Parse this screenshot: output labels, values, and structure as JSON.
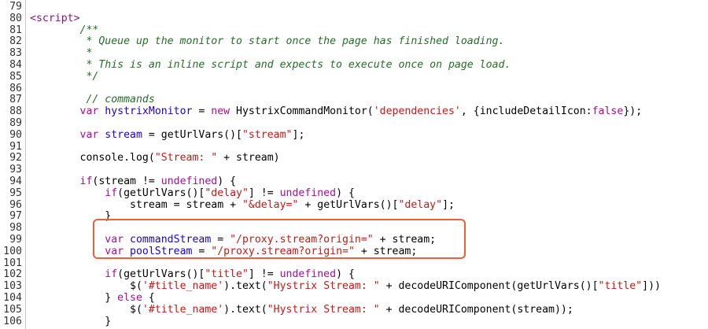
{
  "colors": {
    "tag": "#881280",
    "keyword": "#aa0d91",
    "identifier": "#1c00cf",
    "string": "#c41a16",
    "comment": "#236e25",
    "highlight_border": "#e8603c"
  },
  "lines": [
    {
      "n": "79",
      "indent": "",
      "tokens": []
    },
    {
      "n": "80",
      "indent": "",
      "tokens": [
        {
          "t": "tag",
          "v": "<script>"
        }
      ]
    },
    {
      "n": "81",
      "indent": "        ",
      "tokens": [
        {
          "t": "com",
          "v": "/**"
        }
      ]
    },
    {
      "n": "82",
      "indent": "         ",
      "tokens": [
        {
          "t": "com",
          "v": "* Queue up the monitor to start once the page has finished loading."
        }
      ]
    },
    {
      "n": "83",
      "indent": "         ",
      "tokens": [
        {
          "t": "com",
          "v": "*"
        }
      ]
    },
    {
      "n": "84",
      "indent": "         ",
      "tokens": [
        {
          "t": "com",
          "v": "* This is an inline script and expects to execute once on page load."
        }
      ]
    },
    {
      "n": "85",
      "indent": "         ",
      "tokens": [
        {
          "t": "com",
          "v": "*/"
        }
      ]
    },
    {
      "n": "86",
      "indent": "",
      "tokens": []
    },
    {
      "n": "87",
      "indent": "         ",
      "tokens": [
        {
          "t": "com",
          "v": "// commands"
        }
      ]
    },
    {
      "n": "88",
      "indent": "        ",
      "tokens": [
        {
          "t": "kw",
          "v": "var "
        },
        {
          "t": "var",
          "v": "hystrixMonitor"
        },
        {
          "t": "pl",
          "v": " = "
        },
        {
          "t": "kw",
          "v": "new "
        },
        {
          "t": "pl",
          "v": "HystrixCommandMonitor("
        },
        {
          "t": "str",
          "v": "'dependencies'"
        },
        {
          "t": "pl",
          "v": ", {includeDetailIcon:"
        },
        {
          "t": "kw",
          "v": "false"
        },
        {
          "t": "pl",
          "v": "});"
        }
      ]
    },
    {
      "n": "89",
      "indent": "",
      "tokens": []
    },
    {
      "n": "90",
      "indent": "        ",
      "tokens": [
        {
          "t": "kw",
          "v": "var "
        },
        {
          "t": "var",
          "v": "stream"
        },
        {
          "t": "pl",
          "v": " = getUrlVars()["
        },
        {
          "t": "str",
          "v": "\"stream\""
        },
        {
          "t": "pl",
          "v": "];"
        }
      ]
    },
    {
      "n": "91",
      "indent": "",
      "tokens": []
    },
    {
      "n": "92",
      "indent": "        ",
      "tokens": [
        {
          "t": "pl",
          "v": "console.log("
        },
        {
          "t": "str",
          "v": "\"Stream: \""
        },
        {
          "t": "pl",
          "v": " + stream)"
        }
      ]
    },
    {
      "n": "93",
      "indent": "",
      "tokens": []
    },
    {
      "n": "94",
      "indent": "        ",
      "tokens": [
        {
          "t": "kw",
          "v": "if"
        },
        {
          "t": "pl",
          "v": "(stream != "
        },
        {
          "t": "kw",
          "v": "undefined"
        },
        {
          "t": "pl",
          "v": ") {"
        }
      ]
    },
    {
      "n": "95",
      "indent": "            ",
      "tokens": [
        {
          "t": "kw",
          "v": "if"
        },
        {
          "t": "pl",
          "v": "(getUrlVars()["
        },
        {
          "t": "str",
          "v": "\"delay\""
        },
        {
          "t": "pl",
          "v": "] != "
        },
        {
          "t": "kw",
          "v": "undefined"
        },
        {
          "t": "pl",
          "v": ") {"
        }
      ]
    },
    {
      "n": "96",
      "indent": "                ",
      "tokens": [
        {
          "t": "pl",
          "v": "stream = stream + "
        },
        {
          "t": "str",
          "v": "\"&delay=\""
        },
        {
          "t": "pl",
          "v": " + getUrlVars()["
        },
        {
          "t": "str",
          "v": "\"delay\""
        },
        {
          "t": "pl",
          "v": "];"
        }
      ]
    },
    {
      "n": "97",
      "indent": "            ",
      "tokens": [
        {
          "t": "pl",
          "v": "}"
        }
      ]
    },
    {
      "n": "98",
      "indent": "",
      "tokens": []
    },
    {
      "n": "99",
      "indent": "            ",
      "tokens": [
        {
          "t": "kw",
          "v": "var "
        },
        {
          "t": "var",
          "v": "commandStream"
        },
        {
          "t": "pl",
          "v": " = "
        },
        {
          "t": "str",
          "v": "\"/proxy.stream?origin=\""
        },
        {
          "t": "pl",
          "v": " + stream;"
        }
      ]
    },
    {
      "n": "100",
      "indent": "            ",
      "tokens": [
        {
          "t": "kw",
          "v": "var "
        },
        {
          "t": "var",
          "v": "poolStream"
        },
        {
          "t": "pl",
          "v": " = "
        },
        {
          "t": "str",
          "v": "\"/proxy.stream?origin=\""
        },
        {
          "t": "pl",
          "v": " + stream;"
        }
      ]
    },
    {
      "n": "101",
      "indent": "",
      "tokens": []
    },
    {
      "n": "102",
      "indent": "            ",
      "tokens": [
        {
          "t": "kw",
          "v": "if"
        },
        {
          "t": "pl",
          "v": "(getUrlVars()["
        },
        {
          "t": "str",
          "v": "\"title\""
        },
        {
          "t": "pl",
          "v": "] != "
        },
        {
          "t": "kw",
          "v": "undefined"
        },
        {
          "t": "pl",
          "v": ") {"
        }
      ]
    },
    {
      "n": "103",
      "indent": "                ",
      "tokens": [
        {
          "t": "pl",
          "v": "$("
        },
        {
          "t": "str",
          "v": "'#title_name'"
        },
        {
          "t": "pl",
          "v": ").text("
        },
        {
          "t": "str",
          "v": "\"Hystrix Stream: \""
        },
        {
          "t": "pl",
          "v": " + decodeURIComponent(getUrlVars()["
        },
        {
          "t": "str",
          "v": "\"title\""
        },
        {
          "t": "pl",
          "v": "]))"
        }
      ]
    },
    {
      "n": "104",
      "indent": "            ",
      "tokens": [
        {
          "t": "pl",
          "v": "} "
        },
        {
          "t": "kw",
          "v": "else"
        },
        {
          "t": "pl",
          "v": " {"
        }
      ]
    },
    {
      "n": "105",
      "indent": "                ",
      "tokens": [
        {
          "t": "pl",
          "v": "$("
        },
        {
          "t": "str",
          "v": "'#title_name'"
        },
        {
          "t": "pl",
          "v": ").text("
        },
        {
          "t": "str",
          "v": "\"Hystrix Stream: \""
        },
        {
          "t": "pl",
          "v": " + decodeURIComponent(stream)"
        },
        {
          "t": "pl",
          "v": ");"
        }
      ]
    },
    {
      "n": "106",
      "indent": "            ",
      "tokens": [
        {
          "t": "pl",
          "v": "}"
        }
      ]
    }
  ]
}
